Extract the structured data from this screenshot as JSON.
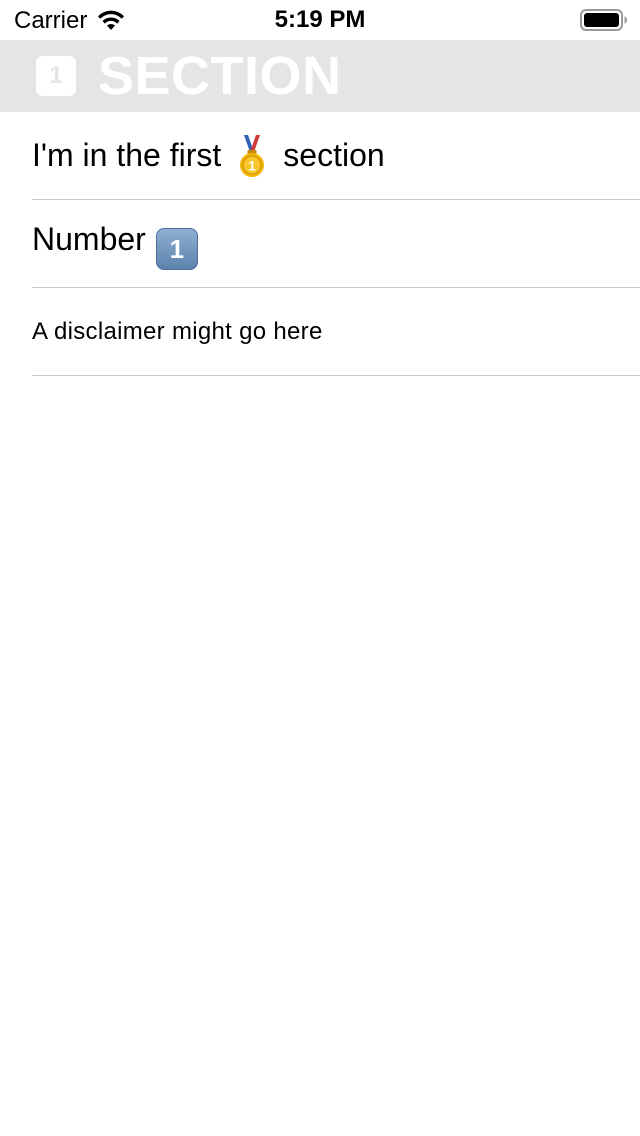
{
  "status_bar": {
    "carrier": "Carrier",
    "time": "5:19 PM"
  },
  "section": {
    "badge": "1",
    "title": "SECTION"
  },
  "rows": [
    {
      "text_before": "I'm in the first",
      "icon": "first-place-medal-icon",
      "text_after": "section"
    },
    {
      "text": "Number",
      "badge": "1"
    },
    {
      "text": "A disclaimer might go here"
    }
  ],
  "colors": {
    "header_background": "#e5e5e5",
    "separator": "#c8c8cc",
    "keycap_blue": "#6f92bb"
  }
}
